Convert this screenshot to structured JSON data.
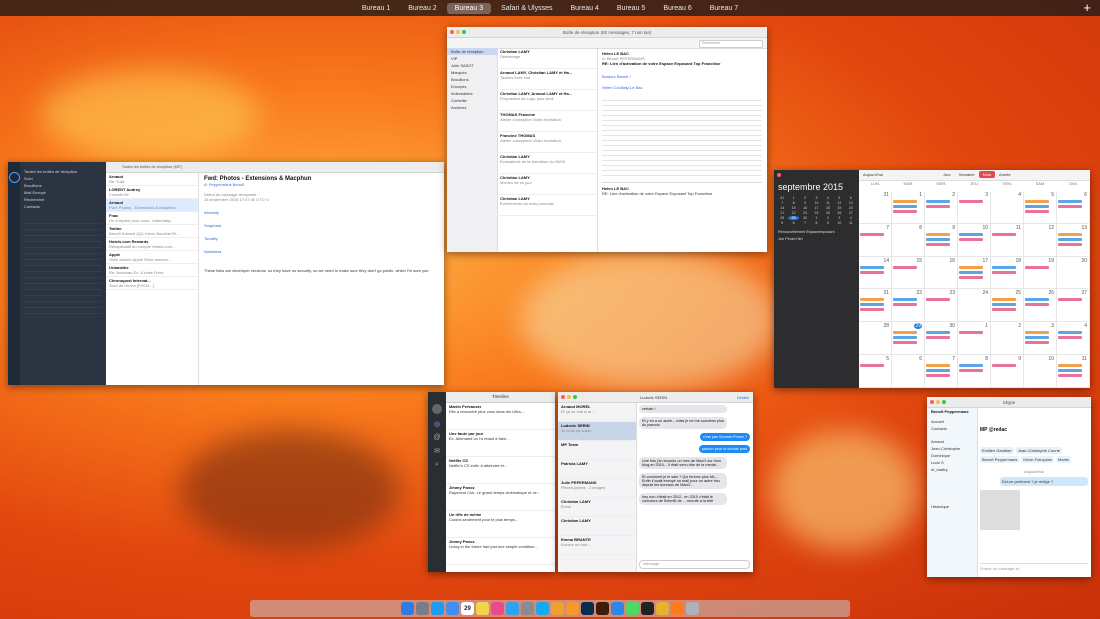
{
  "spaces": [
    "Bureau 1",
    "Bureau 2",
    "Bureau 3",
    "Safari & Ulysses",
    "Bureau 4",
    "Bureau 5",
    "Bureau 6",
    "Bureau 7"
  ],
  "active_space_index": 2,
  "add_space_symbol": "+",
  "mail_left": {
    "title": "Toutes les boîtes de réception (697)",
    "sidebar": [
      "Toutes les boîtes de réception",
      "Suivi",
      "Brouillons",
      "Mail Envoyé",
      "Rechercher",
      "Contacts"
    ],
    "messages": [
      {
        "from": "Arnaud",
        "subject": "Re: Tuile"
      },
      {
        "from": "LORENT Audrey",
        "subject": "Compte Mr"
      },
      {
        "from": "Arnaud",
        "subject": "Fwd: Photos - Extensions & Macphun"
      },
      {
        "from": "Fnac",
        "subject": "On a repéré pour vous : Informatiq..."
      },
      {
        "from": "Twitter",
        "subject": "Benoît Edward (Q4, Kevin Bouchet W..."
      },
      {
        "from": "Hotels.com Rewards",
        "subject": "Récapitulatif du compte Hotels.com..."
      },
      {
        "from": "Apple",
        "subject": "Votre facture Apple Store numéro..."
      },
      {
        "from": "Urbanbike",
        "subject": "Re: Nouveau Ex. & rides Frère"
      },
      {
        "from": "Chronopost Internat...",
        "subject": "Suivi de l'envoi (FX011...)"
      }
    ],
    "open_subject": "Fwd: Photos - Extensions & Macphun",
    "open_from": "Arnaud",
    "open_to": "A: Peppermans Benoît",
    "open_date": "16 septembre 2015 17:47:40 UTC+2",
    "open_intro": "Début du message réexpédié :",
    "links": [
      "Intensify",
      "Snapheal",
      "Tonality",
      "Noiseless"
    ],
    "footer": "These links are developer versions, so they have no security, so we need to make sure they don't go public, which I'm sure you"
  },
  "mail_center": {
    "title": "Boîte de réception (82 messages, 7 non lus)",
    "search_placeholder": "Rechercher",
    "sidebar": [
      "Boîte de réception",
      "VIP",
      "Julie SASOT",
      "Marqués",
      "Brouillons",
      "Envoyés",
      "Indésirables",
      "Corbeille",
      "Archives"
    ],
    "messages": [
      {
        "from": "Christian LAMY",
        "subject": "Démarrage"
      },
      {
        "from": "Arnaud LAMY, Christian LAMY et Ha...",
        "subject": "Tactiles front end"
      },
      {
        "from": "Christian LAMY, Arnaud LAMY et Ha...",
        "subject": "Proposition de Logo pour Amil"
      },
      {
        "from": "THOMAS Francine",
        "subject": "Atelier conception Vidéo formation"
      },
      {
        "from": "Francine THOMAS",
        "subject": "Atelier conception Vidéo formation"
      },
      {
        "from": "Christian LAMY",
        "subject": "Evaluations de la formation du 16/09"
      },
      {
        "from": "Christian LAMY",
        "subject": "Menu/s de ce jour"
      },
      {
        "from": "Christian LAMY",
        "subject": "Évènements du mois prochain"
      }
    ],
    "reader_from": "Helen LE BAC",
    "reader_to": "A: Benoît PEPERMANS",
    "reader_subject": "RE: Lien d'activation de votre Espace Exposant Top Franchise",
    "reader_greeting": "Bonjour Benoît !",
    "reader_sign": "Helen Couillaly-Le Bac",
    "reader2_from": "Helen LE BAC",
    "reader2_subject": "RE: Lien d'activation de votre Espace Exposant Top Franchise"
  },
  "calendar": {
    "month": "septembre 2015",
    "today_label": "Aujourd'hui",
    "views": [
      "Jour",
      "Semaine",
      "Mois",
      "Année"
    ],
    "active_view": "Mois",
    "weekdays": [
      "LUN.",
      "MAR.",
      "MER.",
      "JEU.",
      "VEN.",
      "SAM.",
      "DIM."
    ],
    "days": [
      "31",
      "1",
      "2",
      "3",
      "4",
      "5",
      "6",
      "7",
      "8",
      "9",
      "10",
      "11",
      "12",
      "13",
      "14",
      "15",
      "16",
      "17",
      "18",
      "19",
      "20",
      "21",
      "22",
      "23",
      "24",
      "25",
      "26",
      "27",
      "28",
      "29",
      "30",
      "1",
      "2",
      "3",
      "4",
      "5",
      "6",
      "7",
      "8",
      "9",
      "10",
      "11"
    ],
    "today_day": "29",
    "upcoming": [
      "Renouvellement Espaceexposant",
      "Joe Pèrard Nrt"
    ],
    "colors": {
      "today": "#1f7de6",
      "event_green": "#58c25b",
      "event_orange": "#f4a04a",
      "event_blue": "#5aa5e8",
      "event_pink": "#e8729a"
    }
  },
  "tweetbot": {
    "title": "Timeline",
    "tweets": [
      {
        "name": "Martin Prévauser",
        "text": "Elle a rencontré plus vous dans les Ultra-..."
      },
      {
        "name": "Une faute par jour",
        "text": "Ex. Allemand on l'a réduit à faire..."
      },
      {
        "name": "Netflix CS",
        "text": "Netflix's CS enfin à atteindre et..."
      },
      {
        "name": "Jimmy Panoz",
        "text": "Raymond Cuir. Le grand temps cinématique et ce..."
      },
      {
        "name": "Un rifle de même",
        "text": "Coloris seulement pour le plus temps..."
      },
      {
        "name": "Jimmy Panoz",
        "text": "Living in the future had just one simple condition..."
      }
    ]
  },
  "messages_app": {
    "header_name": "Ludovic SERIN",
    "details": "Détails",
    "conversations": [
      {
        "name": "Arnaud MOREL",
        "snippet": "Et ça se voit si tu ..."
      },
      {
        "name": "Ludovic SERIN",
        "snippet": "Je crois ça aussi..."
      },
      {
        "name": "MP Team",
        "snippet": ""
      },
      {
        "name": "Patricia LAMY",
        "snippet": ""
      },
      {
        "name": "Julie PEPERMANS",
        "snippet": "Pièces jointes : 2 images"
      },
      {
        "name": "Christian LAMY",
        "snippet": "Envoi"
      },
      {
        "name": "Christian LAMY",
        "snippet": ""
      },
      {
        "name": "Emma BRANTE",
        "snippet": "Encore un mot..."
      }
    ],
    "bubbles": [
      {
        "dir": "in",
        "text": "certain !"
      },
      {
        "dir": "in",
        "text": "Et y en a un autre... mais je ne me souviens plus du pseudo"
      },
      {
        "dir": "out",
        "text": "c'est pas Scream Prince ?"
      },
      {
        "dir": "out",
        "text": "pardon pour le double post"
      },
      {
        "dir": "in",
        "text": "Une fois j'ai reconnu un mec de MacG sur mon blog en 2010... Il était venu dire de la merde..."
      },
      {
        "dir": "in",
        "text": "Et comment je le sais ? Qui ferions plus ML... Enfin il avait envoyé un mail pour un autre truc depuis les bureaux de MacG..."
      },
      {
        "dir": "in",
        "text": "hey non c'était en 2012.. en 2010 c'était le concours de Schmitt de ... recruté à la télé"
      }
    ],
    "input_placeholder": "iMessage"
  },
  "skype": {
    "title": "Skype",
    "user": "Benoît Peppermans",
    "menu": [
      "Accueil",
      "Contacts"
    ],
    "recents": [
      "Arnaud",
      "Jean-Christophe",
      "Dominique",
      "Ludo S",
      "nt_mattry"
    ],
    "chat_name": "MP @redac",
    "participants": [
      "Emilien Gauthier",
      "Jean-Christophe Courte",
      "Benoît Peppermans",
      "Kevin Françoise",
      "Martin"
    ],
    "today_label": "Aujourd'hui",
    "msg": "Est-ce pertinent ? je rédige ?",
    "input_placeholder": "Entrez un message ici",
    "historique": "Historique"
  },
  "dock_icons": [
    "finder-icon",
    "launchpad-icon",
    "safari-icon",
    "mail-icon",
    "calendar-icon",
    "notes-icon",
    "itunes-icon",
    "appstore-icon",
    "preferences-icon",
    "skype-icon",
    "photos-icon",
    "pages-icon",
    "photoshop-icon",
    "illustrator-icon",
    "tweetbot-icon",
    "messages-icon",
    "terminal-icon",
    "chrome-icon",
    "firefox-icon",
    "trash-icon"
  ],
  "dock_calendar_day": "29"
}
